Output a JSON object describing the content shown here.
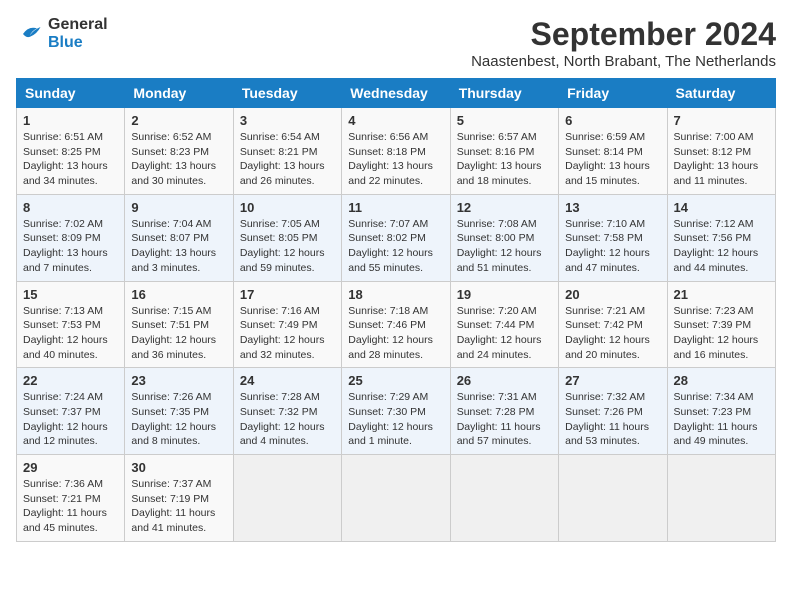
{
  "logo": {
    "line1": "General",
    "line2": "Blue"
  },
  "title": "September 2024",
  "subtitle": "Naastenbest, North Brabant, The Netherlands",
  "days_header": [
    "Sunday",
    "Monday",
    "Tuesday",
    "Wednesday",
    "Thursday",
    "Friday",
    "Saturday"
  ],
  "weeks": [
    [
      {
        "day": "1",
        "info": "Sunrise: 6:51 AM\nSunset: 8:25 PM\nDaylight: 13 hours\nand 34 minutes."
      },
      {
        "day": "2",
        "info": "Sunrise: 6:52 AM\nSunset: 8:23 PM\nDaylight: 13 hours\nand 30 minutes."
      },
      {
        "day": "3",
        "info": "Sunrise: 6:54 AM\nSunset: 8:21 PM\nDaylight: 13 hours\nand 26 minutes."
      },
      {
        "day": "4",
        "info": "Sunrise: 6:56 AM\nSunset: 8:18 PM\nDaylight: 13 hours\nand 22 minutes."
      },
      {
        "day": "5",
        "info": "Sunrise: 6:57 AM\nSunset: 8:16 PM\nDaylight: 13 hours\nand 18 minutes."
      },
      {
        "day": "6",
        "info": "Sunrise: 6:59 AM\nSunset: 8:14 PM\nDaylight: 13 hours\nand 15 minutes."
      },
      {
        "day": "7",
        "info": "Sunrise: 7:00 AM\nSunset: 8:12 PM\nDaylight: 13 hours\nand 11 minutes."
      }
    ],
    [
      {
        "day": "8",
        "info": "Sunrise: 7:02 AM\nSunset: 8:09 PM\nDaylight: 13 hours\nand 7 minutes."
      },
      {
        "day": "9",
        "info": "Sunrise: 7:04 AM\nSunset: 8:07 PM\nDaylight: 13 hours\nand 3 minutes."
      },
      {
        "day": "10",
        "info": "Sunrise: 7:05 AM\nSunset: 8:05 PM\nDaylight: 12 hours\nand 59 minutes."
      },
      {
        "day": "11",
        "info": "Sunrise: 7:07 AM\nSunset: 8:02 PM\nDaylight: 12 hours\nand 55 minutes."
      },
      {
        "day": "12",
        "info": "Sunrise: 7:08 AM\nSunset: 8:00 PM\nDaylight: 12 hours\nand 51 minutes."
      },
      {
        "day": "13",
        "info": "Sunrise: 7:10 AM\nSunset: 7:58 PM\nDaylight: 12 hours\nand 47 minutes."
      },
      {
        "day": "14",
        "info": "Sunrise: 7:12 AM\nSunset: 7:56 PM\nDaylight: 12 hours\nand 44 minutes."
      }
    ],
    [
      {
        "day": "15",
        "info": "Sunrise: 7:13 AM\nSunset: 7:53 PM\nDaylight: 12 hours\nand 40 minutes."
      },
      {
        "day": "16",
        "info": "Sunrise: 7:15 AM\nSunset: 7:51 PM\nDaylight: 12 hours\nand 36 minutes."
      },
      {
        "day": "17",
        "info": "Sunrise: 7:16 AM\nSunset: 7:49 PM\nDaylight: 12 hours\nand 32 minutes."
      },
      {
        "day": "18",
        "info": "Sunrise: 7:18 AM\nSunset: 7:46 PM\nDaylight: 12 hours\nand 28 minutes."
      },
      {
        "day": "19",
        "info": "Sunrise: 7:20 AM\nSunset: 7:44 PM\nDaylight: 12 hours\nand 24 minutes."
      },
      {
        "day": "20",
        "info": "Sunrise: 7:21 AM\nSunset: 7:42 PM\nDaylight: 12 hours\nand 20 minutes."
      },
      {
        "day": "21",
        "info": "Sunrise: 7:23 AM\nSunset: 7:39 PM\nDaylight: 12 hours\nand 16 minutes."
      }
    ],
    [
      {
        "day": "22",
        "info": "Sunrise: 7:24 AM\nSunset: 7:37 PM\nDaylight: 12 hours\nand 12 minutes."
      },
      {
        "day": "23",
        "info": "Sunrise: 7:26 AM\nSunset: 7:35 PM\nDaylight: 12 hours\nand 8 minutes."
      },
      {
        "day": "24",
        "info": "Sunrise: 7:28 AM\nSunset: 7:32 PM\nDaylight: 12 hours\nand 4 minutes."
      },
      {
        "day": "25",
        "info": "Sunrise: 7:29 AM\nSunset: 7:30 PM\nDaylight: 12 hours\nand 1 minute."
      },
      {
        "day": "26",
        "info": "Sunrise: 7:31 AM\nSunset: 7:28 PM\nDaylight: 11 hours\nand 57 minutes."
      },
      {
        "day": "27",
        "info": "Sunrise: 7:32 AM\nSunset: 7:26 PM\nDaylight: 11 hours\nand 53 minutes."
      },
      {
        "day": "28",
        "info": "Sunrise: 7:34 AM\nSunset: 7:23 PM\nDaylight: 11 hours\nand 49 minutes."
      }
    ],
    [
      {
        "day": "29",
        "info": "Sunrise: 7:36 AM\nSunset: 7:21 PM\nDaylight: 11 hours\nand 45 minutes."
      },
      {
        "day": "30",
        "info": "Sunrise: 7:37 AM\nSunset: 7:19 PM\nDaylight: 11 hours\nand 41 minutes."
      },
      {
        "day": "",
        "info": ""
      },
      {
        "day": "",
        "info": ""
      },
      {
        "day": "",
        "info": ""
      },
      {
        "day": "",
        "info": ""
      },
      {
        "day": "",
        "info": ""
      }
    ]
  ]
}
